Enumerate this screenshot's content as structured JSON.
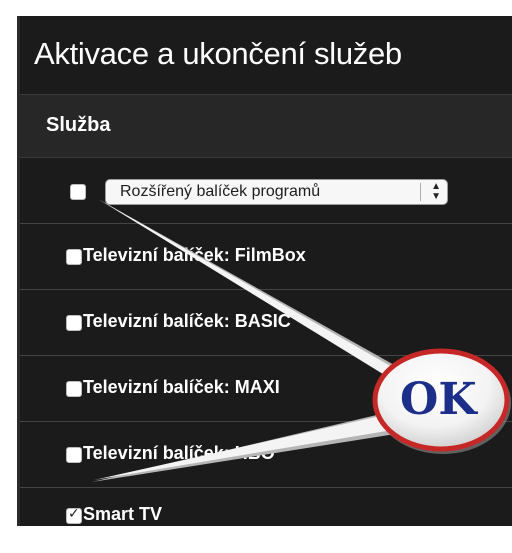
{
  "title": "Aktivace a ukončení služeb",
  "table": {
    "header": "Služba",
    "select": {
      "value": "Rozšířený balíček programů"
    },
    "rows": [
      {
        "label": "Televizní balíček: FilmBox",
        "checked": false
      },
      {
        "label": "Televizní balíček: BASIC",
        "checked": false
      },
      {
        "label": "Televizní balíček: MAXI",
        "checked": false
      },
      {
        "label": "Televizní balíček: HBO",
        "checked": false
      },
      {
        "label": "Smart TV",
        "checked": true
      }
    ]
  },
  "callout": {
    "text": "OK"
  },
  "colors": {
    "panel": "#1b1b1b",
    "header": "#272727",
    "callout_text": "#1b2f8a"
  }
}
